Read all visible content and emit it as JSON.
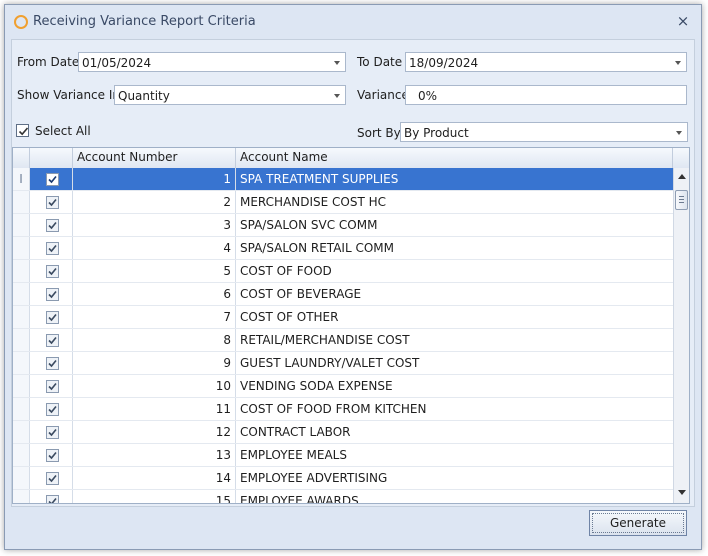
{
  "window": {
    "title": "Receiving Variance Report Criteria",
    "close_glyph": "×"
  },
  "criteria": {
    "from_date_label": "From Date",
    "from_date_value": "01/05/2024",
    "to_date_label": "To Date",
    "to_date_value": "18/09/2024",
    "show_variance_label": "Show Variance In",
    "show_variance_value": "Quantity",
    "variance_label": "Variance",
    "variance_value": "0%",
    "select_all_label": "Select All",
    "select_all_checked": true,
    "sort_by_label": "Sort By",
    "sort_by_value": "By Product"
  },
  "grid": {
    "columns": [
      "Account Number",
      "Account Name"
    ],
    "selected_indicator": "I",
    "rows": [
      {
        "number": "1",
        "name": "SPA TREATMENT SUPPLIES",
        "checked": true,
        "selected": true
      },
      {
        "number": "2",
        "name": "MERCHANDISE COST HC",
        "checked": true
      },
      {
        "number": "3",
        "name": "SPA/SALON SVC COMM",
        "checked": true
      },
      {
        "number": "4",
        "name": "SPA/SALON RETAIL COMM",
        "checked": true
      },
      {
        "number": "5",
        "name": "COST OF FOOD",
        "checked": true
      },
      {
        "number": "6",
        "name": "COST OF BEVERAGE",
        "checked": true
      },
      {
        "number": "7",
        "name": "COST OF OTHER",
        "checked": true
      },
      {
        "number": "8",
        "name": "RETAIL/MERCHANDISE COST",
        "checked": true
      },
      {
        "number": "9",
        "name": "GUEST LAUNDRY/VALET COST",
        "checked": true
      },
      {
        "number": "10",
        "name": "VENDING SODA EXPENSE",
        "checked": true
      },
      {
        "number": "11",
        "name": "COST OF FOOD FROM KITCHEN",
        "checked": true
      },
      {
        "number": "12",
        "name": "CONTRACT LABOR",
        "checked": true
      },
      {
        "number": "13",
        "name": "EMPLOYEE MEALS",
        "checked": true
      },
      {
        "number": "14",
        "name": "EMPLOYEE ADVERTISING",
        "checked": true
      },
      {
        "number": "15",
        "name": "EMPLOYEE AWARDS",
        "checked": true
      }
    ]
  },
  "footer": {
    "generate_label": "Generate"
  },
  "colors": {
    "selection": "#3874d0",
    "title_icon": "#f0a030"
  }
}
